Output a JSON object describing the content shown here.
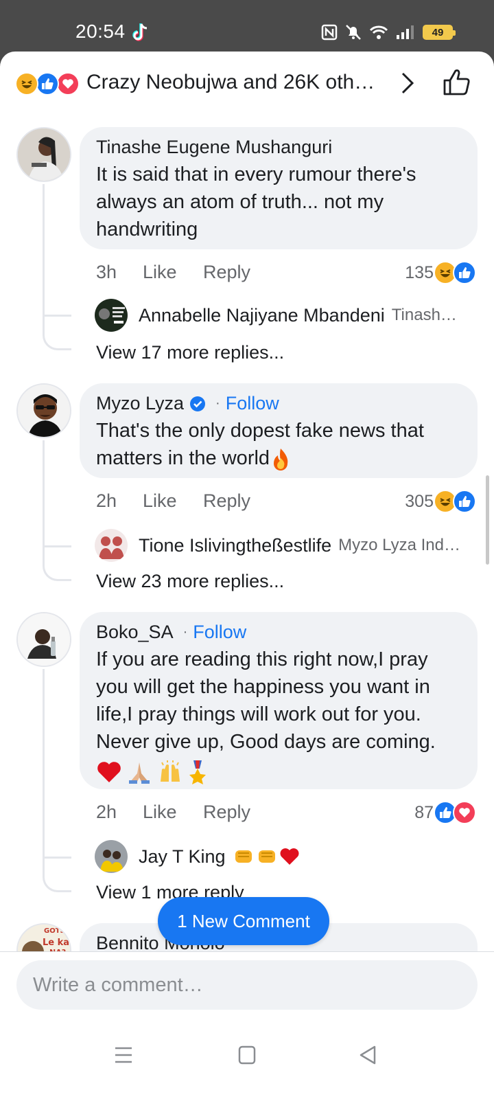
{
  "status_bar": {
    "time": "20:54",
    "battery": "49"
  },
  "header": {
    "reactions": [
      "haha-icon",
      "like-icon",
      "love-icon"
    ],
    "text": "Crazy Neobujwa and 26K oth…"
  },
  "comments": [
    {
      "author": "Tinashe Eugene Mushanguri",
      "text": "It is said that in every rumour there's always an atom of truth... not my handwriting",
      "time": "3h",
      "like": "Like",
      "reply": "Reply",
      "reaction_count": "135",
      "reactions": [
        "haha-icon",
        "like-icon"
      ],
      "reply_preview": {
        "name": "Annabelle Najiyane Mbandeni",
        "snippet": "Tinash…"
      },
      "view_more": "View 17 more replies..."
    },
    {
      "author": "Myzo Lyza",
      "verified": true,
      "follow": "Follow",
      "text": "That's the only dopest fake news that matters in the world",
      "time": "2h",
      "like": "Like",
      "reply": "Reply",
      "reaction_count": "305",
      "reactions": [
        "haha-icon",
        "like-icon"
      ],
      "reply_preview": {
        "name": "Tione Islivingtheßestlife",
        "snippet": "Myzo Lyza Ind…"
      },
      "view_more": "View 23 more replies..."
    },
    {
      "author": "Boko_SA",
      "follow": "Follow",
      "text": "If you are reading this right now,I pray you will get the happiness you want in life,I pray things will work out for you. Never give up, Good days are coming.",
      "time": "2h",
      "like": "Like",
      "reply": "Reply",
      "reaction_count": "87",
      "reactions": [
        "like-icon",
        "love-icon"
      ],
      "reply_preview": {
        "name": "Jay T King",
        "snippet": ""
      },
      "view_more": "View 1 more reply"
    },
    {
      "author": "Bennito Monolo",
      "avatar_text": [
        "GOTSO",
        "Le kae",
        "NA?"
      ]
    }
  ],
  "new_comment_pill": "1 New Comment",
  "composer": {
    "placeholder": "Write a comment…"
  },
  "colors": {
    "accent": "#1877f2",
    "bubble": "#f0f2f5",
    "love": "#f33e58",
    "haha": "#f7b125"
  }
}
